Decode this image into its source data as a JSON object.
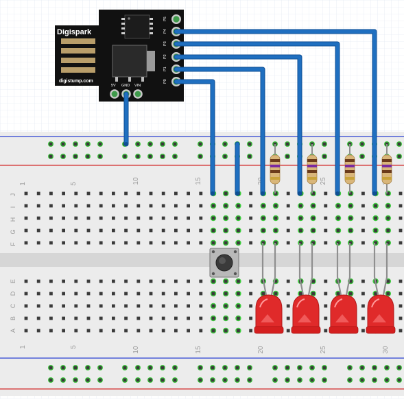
{
  "board": {
    "brand": "Digispark",
    "url": "digistump.com",
    "pins": [
      "P5",
      "P4",
      "P3",
      "P2",
      "P1",
      "P0"
    ],
    "power_pins": [
      "5V",
      "GND",
      "VIN"
    ]
  },
  "breadboard": {
    "column_numbers": [
      "1",
      "5",
      "10",
      "15",
      "20",
      "25",
      "30"
    ],
    "top_rows": [
      "J",
      "I",
      "H",
      "G",
      "F"
    ],
    "bottom_rows": [
      "E",
      "D",
      "C",
      "B",
      "A"
    ]
  },
  "colors": {
    "wire": "#1f6fc0",
    "wire_edge": "#0f4f94",
    "led": "#e02a2a",
    "board": "#111111",
    "rail_red": "#d22a2a",
    "rail_blue": "#2a3fd2",
    "hole_active": "#3ecb3e",
    "grid": "#d8e2f0"
  }
}
